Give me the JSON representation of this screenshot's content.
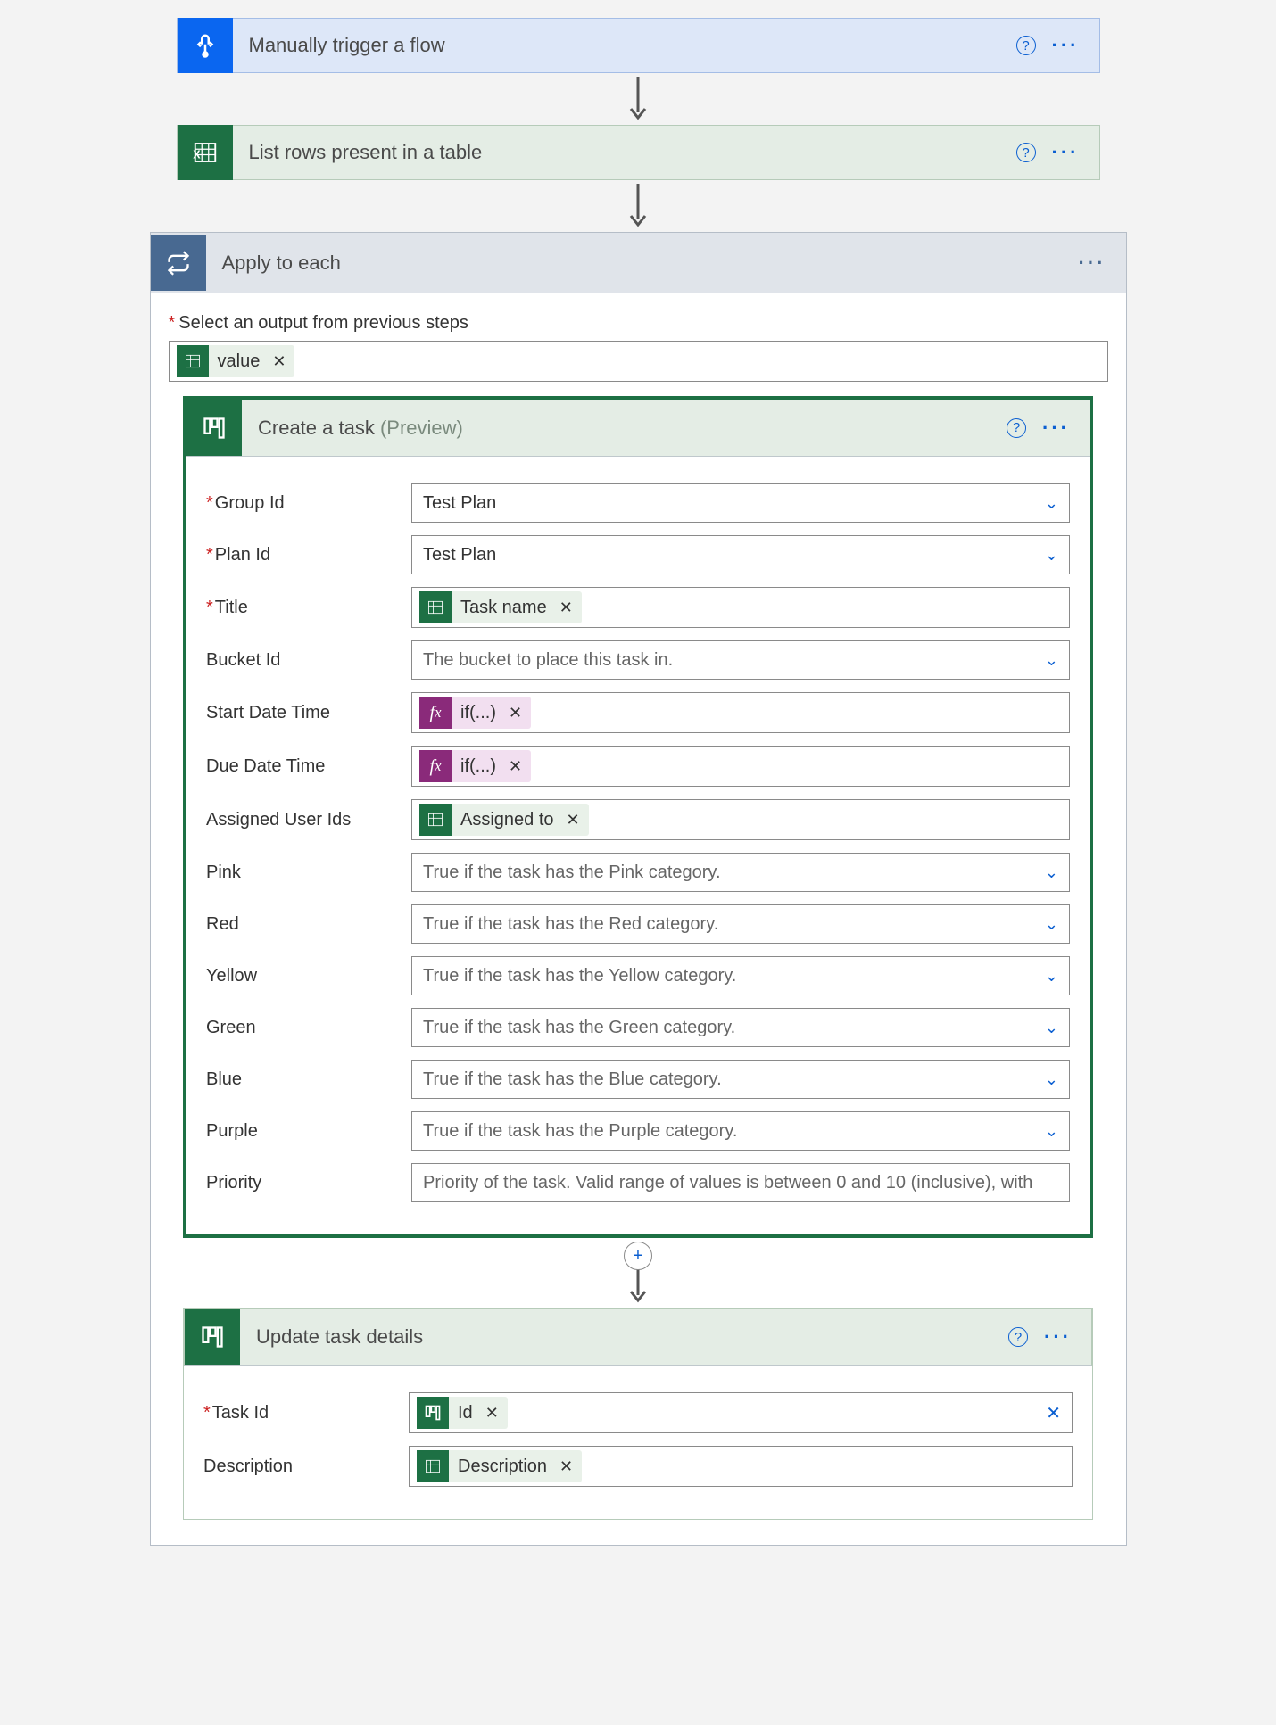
{
  "steps": {
    "trigger": {
      "title": "Manually trigger a flow"
    },
    "listRows": {
      "title": "List rows present in a table"
    },
    "applyEach": {
      "title": "Apply to each",
      "inputLabel": "Select an output from previous steps",
      "token": "value"
    }
  },
  "createTask": {
    "title": "Create a task",
    "previewTag": "(Preview)",
    "fields": {
      "groupId": {
        "label": "Group Id",
        "value": "Test Plan",
        "required": true,
        "type": "select"
      },
      "planId": {
        "label": "Plan Id",
        "value": "Test Plan",
        "required": true,
        "type": "select"
      },
      "title": {
        "label": "Title",
        "token": "Task name",
        "required": true
      },
      "bucketId": {
        "label": "Bucket Id",
        "placeholder": "The bucket to place this task in.",
        "type": "select"
      },
      "startDate": {
        "label": "Start Date Time",
        "fx": "if(...)"
      },
      "dueDate": {
        "label": "Due Date Time",
        "fx": "if(...)"
      },
      "assigned": {
        "label": "Assigned User Ids",
        "token": "Assigned to"
      },
      "pink": {
        "label": "Pink",
        "placeholder": "True if the task has the Pink category.",
        "type": "select"
      },
      "red": {
        "label": "Red",
        "placeholder": "True if the task has the Red category.",
        "type": "select"
      },
      "yellow": {
        "label": "Yellow",
        "placeholder": "True if the task has the Yellow category.",
        "type": "select"
      },
      "green": {
        "label": "Green",
        "placeholder": "True if the task has the Green category.",
        "type": "select"
      },
      "blue": {
        "label": "Blue",
        "placeholder": "True if the task has the Blue category.",
        "type": "select"
      },
      "purple": {
        "label": "Purple",
        "placeholder": "True if the task has the Purple category.",
        "type": "select"
      },
      "priority": {
        "label": "Priority",
        "placeholder": "Priority of the task. Valid range of values is between 0 and 10 (inclusive), with"
      }
    }
  },
  "updateTask": {
    "title": "Update task details",
    "fields": {
      "taskId": {
        "label": "Task Id",
        "token": "Id",
        "required": true,
        "clearable": true
      },
      "description": {
        "label": "Description",
        "token": "Description"
      }
    }
  }
}
